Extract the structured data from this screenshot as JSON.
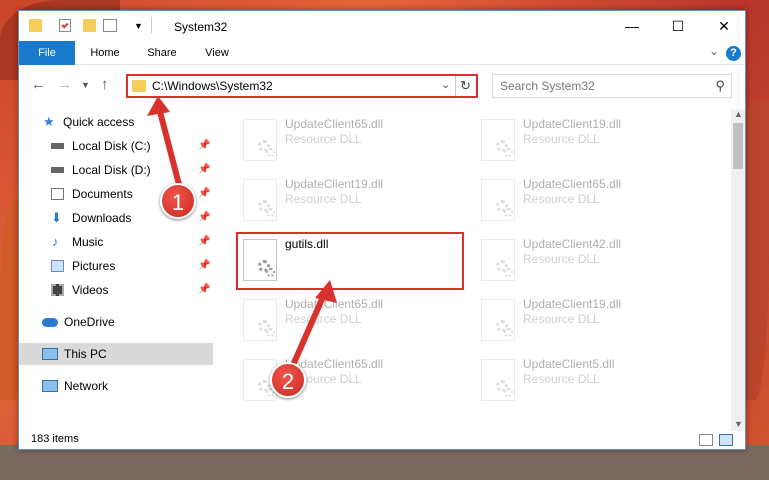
{
  "window": {
    "title": "System32",
    "minimize": "—",
    "maximize": "☐",
    "close": "✕"
  },
  "ribbon": {
    "tabs": [
      "File",
      "Home",
      "Share",
      "View"
    ],
    "help": "?"
  },
  "address": {
    "path": "C:\\Windows\\System32"
  },
  "search": {
    "placeholder": "Search System32"
  },
  "sidebar": {
    "items": [
      {
        "label": "Quick access",
        "icon": "star-icon",
        "pinned": false
      },
      {
        "label": "Local Disk (C:)",
        "icon": "drive-icon",
        "pinned": true
      },
      {
        "label": "Local Disk (D:)",
        "icon": "drive-icon",
        "pinned": true
      },
      {
        "label": "Documents",
        "icon": "documents-icon",
        "pinned": true
      },
      {
        "label": "Downloads",
        "icon": "downloads-icon",
        "pinned": true
      },
      {
        "label": "Music",
        "icon": "music-icon",
        "pinned": true
      },
      {
        "label": "Pictures",
        "icon": "pictures-icon",
        "pinned": true
      },
      {
        "label": "Videos",
        "icon": "videos-icon",
        "pinned": true
      },
      {
        "label": "OneDrive",
        "icon": "cloud-icon",
        "pinned": false
      },
      {
        "label": "This PC",
        "icon": "computer-icon",
        "pinned": false,
        "selected": true
      },
      {
        "label": "Network",
        "icon": "network-icon",
        "pinned": false
      }
    ]
  },
  "files": [
    {
      "name": "UpdateClient65.dll",
      "type": "Resource DLL",
      "faded": true
    },
    {
      "name": "UpdateClient19.dll",
      "type": "Resource DLL",
      "faded": true
    },
    {
      "name": "UpdateClient19.dll",
      "type": "Resource DLL",
      "faded": true
    },
    {
      "name": "UpdateClient65.dll",
      "type": "Resource DLL",
      "faded": true
    },
    {
      "name": "gutils.dll",
      "type": "",
      "faded": false
    },
    {
      "name": "UpdateClient42.dll",
      "type": "Resource DLL",
      "faded": true
    },
    {
      "name": "UpdateClient65.dll",
      "type": "Resource DLL",
      "faded": true
    },
    {
      "name": "UpdateClient19.dll",
      "type": "Resource DLL",
      "faded": true
    },
    {
      "name": "UpdateClient65.dll",
      "type": "Resource DLL",
      "faded": true
    },
    {
      "name": "UpdateClient5.dll",
      "type": "Resource DLL",
      "faded": true
    }
  ],
  "status": {
    "item_count": "183 items"
  },
  "annotations": {
    "step1": "1",
    "step2": "2",
    "accent_color": "#d9322e"
  }
}
